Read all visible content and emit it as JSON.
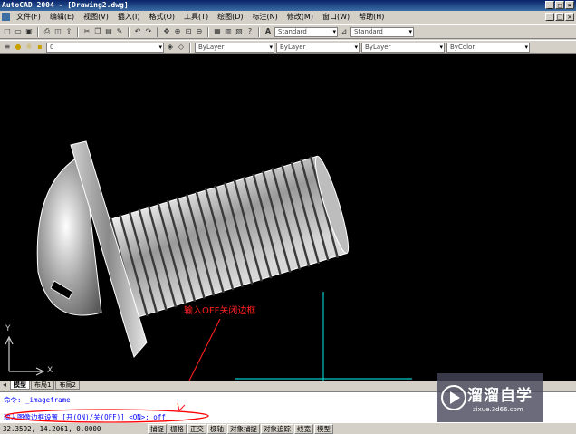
{
  "window": {
    "title": "AutoCAD 2004 - [Drawing2.dwg]",
    "btn_min": "_",
    "btn_max": "□",
    "btn_close": "×"
  },
  "menu": {
    "items": [
      "文件(F)",
      "编辑(E)",
      "视图(V)",
      "插入(I)",
      "格式(O)",
      "工具(T)",
      "绘图(D)",
      "标注(N)",
      "修改(M)",
      "窗口(W)",
      "帮助(H)"
    ]
  },
  "toolbar1": {
    "text_style": "Standard",
    "dim_style": "Standard",
    "text_style_icon": "A"
  },
  "toolbar2": {
    "layer": "0",
    "color": "ByLayer",
    "linetype": "ByLayer",
    "lineweight": "ByLayer",
    "plotstyle": "ByColor"
  },
  "annotation": "输入OFF关闭边框",
  "ucs": {
    "x": "X",
    "y": "Y"
  },
  "tabs": [
    "模型",
    "布局1",
    "布局2"
  ],
  "command": {
    "line1": "命令: _imageframe",
    "line2": "输入图像边框设置 [开(ON)/关(OFF)] <ON>: off"
  },
  "status": {
    "coords": "32.3592, 14.2061, 0.0000",
    "buttons": [
      "捕捉",
      "栅格",
      "正交",
      "极轴",
      "对象捕捉",
      "对象追踪",
      "线宽",
      "模型"
    ]
  },
  "watermark": {
    "main": "溜溜自学",
    "sub": "zixue.3d66.com"
  },
  "colors": {
    "annotation": "#ff2020",
    "command_text": "#0000ff",
    "canvas": "#000000",
    "highlight_ellipse": "#ff0000"
  }
}
